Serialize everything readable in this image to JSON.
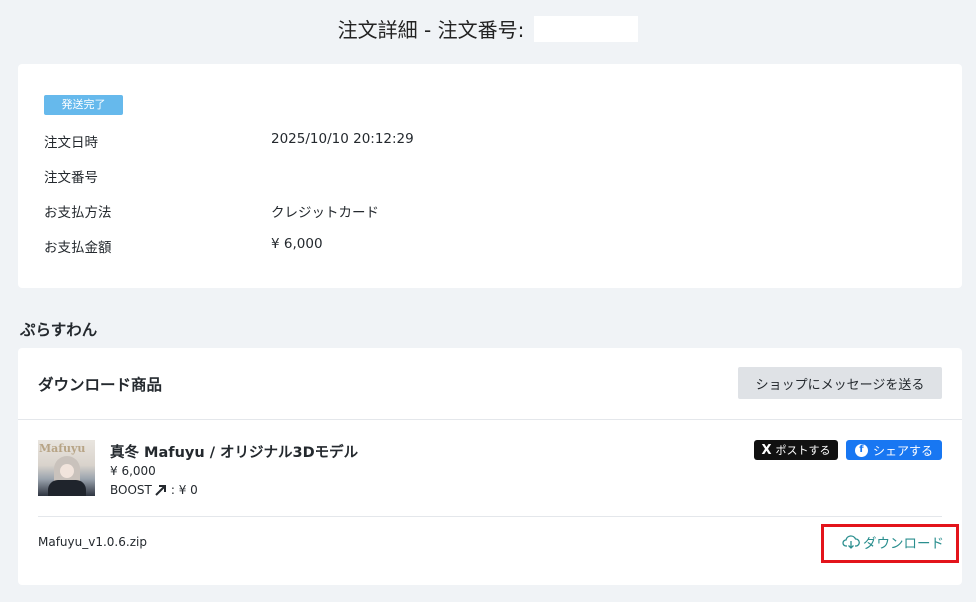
{
  "header": {
    "title": "注文詳細 - 注文番号:"
  },
  "summary": {
    "status_badge": "発送完了",
    "rows": [
      {
        "label": "注文日時",
        "value": "2025/10/10 20:12:29"
      },
      {
        "label": "注文番号",
        "value": ""
      },
      {
        "label": "お支払方法",
        "value": "クレジットカード"
      },
      {
        "label": "お支払金額",
        "value": "¥ 6,000"
      }
    ]
  },
  "shop": {
    "name": "ぷらすわん"
  },
  "product_section": {
    "title": "ダウンロード商品",
    "message_button": "ショップにメッセージを送る",
    "product": {
      "thumb_logo": "Mafuyu",
      "title": "真冬 Mafuyu / オリジナル3Dモデル",
      "price": "¥ 6,000",
      "boost_label": "BOOST",
      "boost_value": ": ¥ 0"
    },
    "share": {
      "x_label": "ポストする",
      "x_icon": "X",
      "fb_label": "シェアする",
      "fb_icon": "f"
    },
    "file": {
      "name": "Mafuyu_v1.0.6.zip",
      "download_label": "ダウンロード"
    }
  },
  "colors": {
    "background": "#f0f3f6",
    "badge": "#66b9ec",
    "download_link": "#2a8e8e",
    "highlight": "#e3141b",
    "facebook": "#1877f2"
  }
}
